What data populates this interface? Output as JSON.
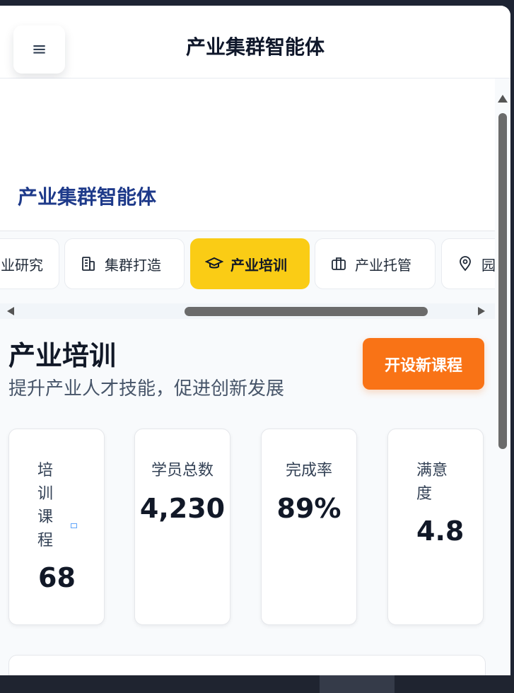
{
  "app": {
    "title": "产业集群智能体"
  },
  "hero": {
    "title": "产业集群智能体"
  },
  "tabs": [
    {
      "label": "业研究",
      "icon": "research-icon"
    },
    {
      "label": "集群打造",
      "icon": "building-icon"
    },
    {
      "label": "产业培训",
      "icon": "graduation-cap-icon",
      "active": true
    },
    {
      "label": "产业托管",
      "icon": "briefcase-icon"
    },
    {
      "label": "园",
      "icon": "location-pin-icon"
    }
  ],
  "section": {
    "title": "产业培训",
    "subtitle": "提升产业人才技能，促进创新发展",
    "cta_label": "开设新课程"
  },
  "stats": [
    {
      "label": "培训课程",
      "value": "68"
    },
    {
      "label": "学员总数",
      "value": "4,230"
    },
    {
      "label": "完成率",
      "value": "89%"
    },
    {
      "label": "满意度",
      "value": "4.8"
    }
  ],
  "colors": {
    "accent_yellow": "#facc15",
    "cta_orange": "#f97316",
    "hero_title_blue": "#1e3a8a"
  }
}
